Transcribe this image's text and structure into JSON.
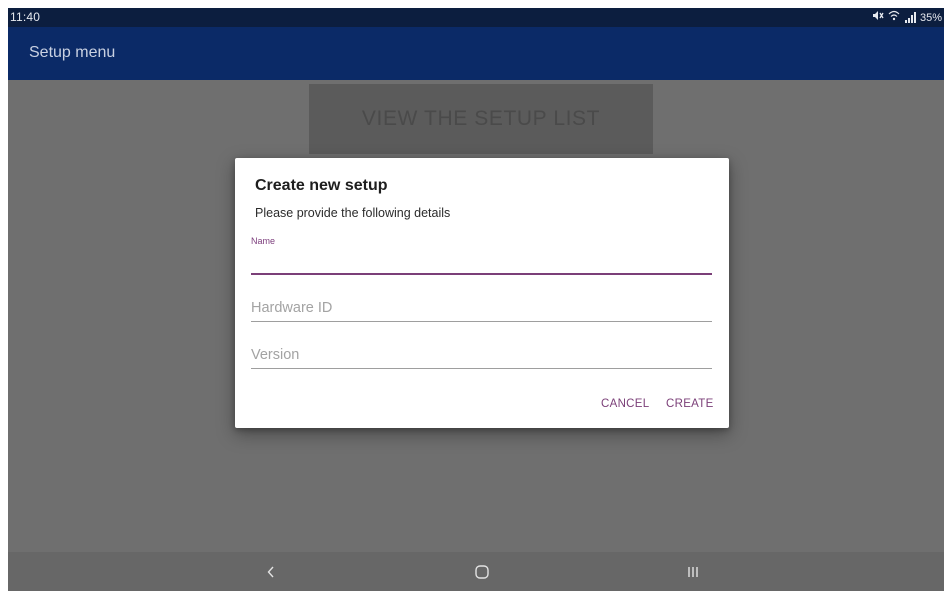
{
  "status_bar": {
    "time": "11:40",
    "mute_icon": "mute-icon",
    "wifi_icon": "wifi-icon",
    "signal_icon": "signal-icon",
    "battery": "35%"
  },
  "app_bar": {
    "title": "Setup menu"
  },
  "main": {
    "view_setup_list_label": "VIEW THE SETUP LIST"
  },
  "dialog": {
    "title": "Create new setup",
    "subtitle": "Please provide the following details",
    "fields": {
      "name": {
        "label": "Name",
        "value": ""
      },
      "hardware_id": {
        "placeholder": "Hardware ID",
        "value": ""
      },
      "version": {
        "placeholder": "Version",
        "value": ""
      }
    },
    "actions": {
      "cancel": "CANCEL",
      "create": "CREATE"
    }
  },
  "nav_bar": {
    "back_icon": "back-icon",
    "home_icon": "home-icon",
    "recents_icon": "recents-icon"
  },
  "colors": {
    "status_bar": "#0c1e3f",
    "app_bar": "#0b2a67",
    "accent": "#7b3f78",
    "scrim": "#6f6f6f"
  }
}
